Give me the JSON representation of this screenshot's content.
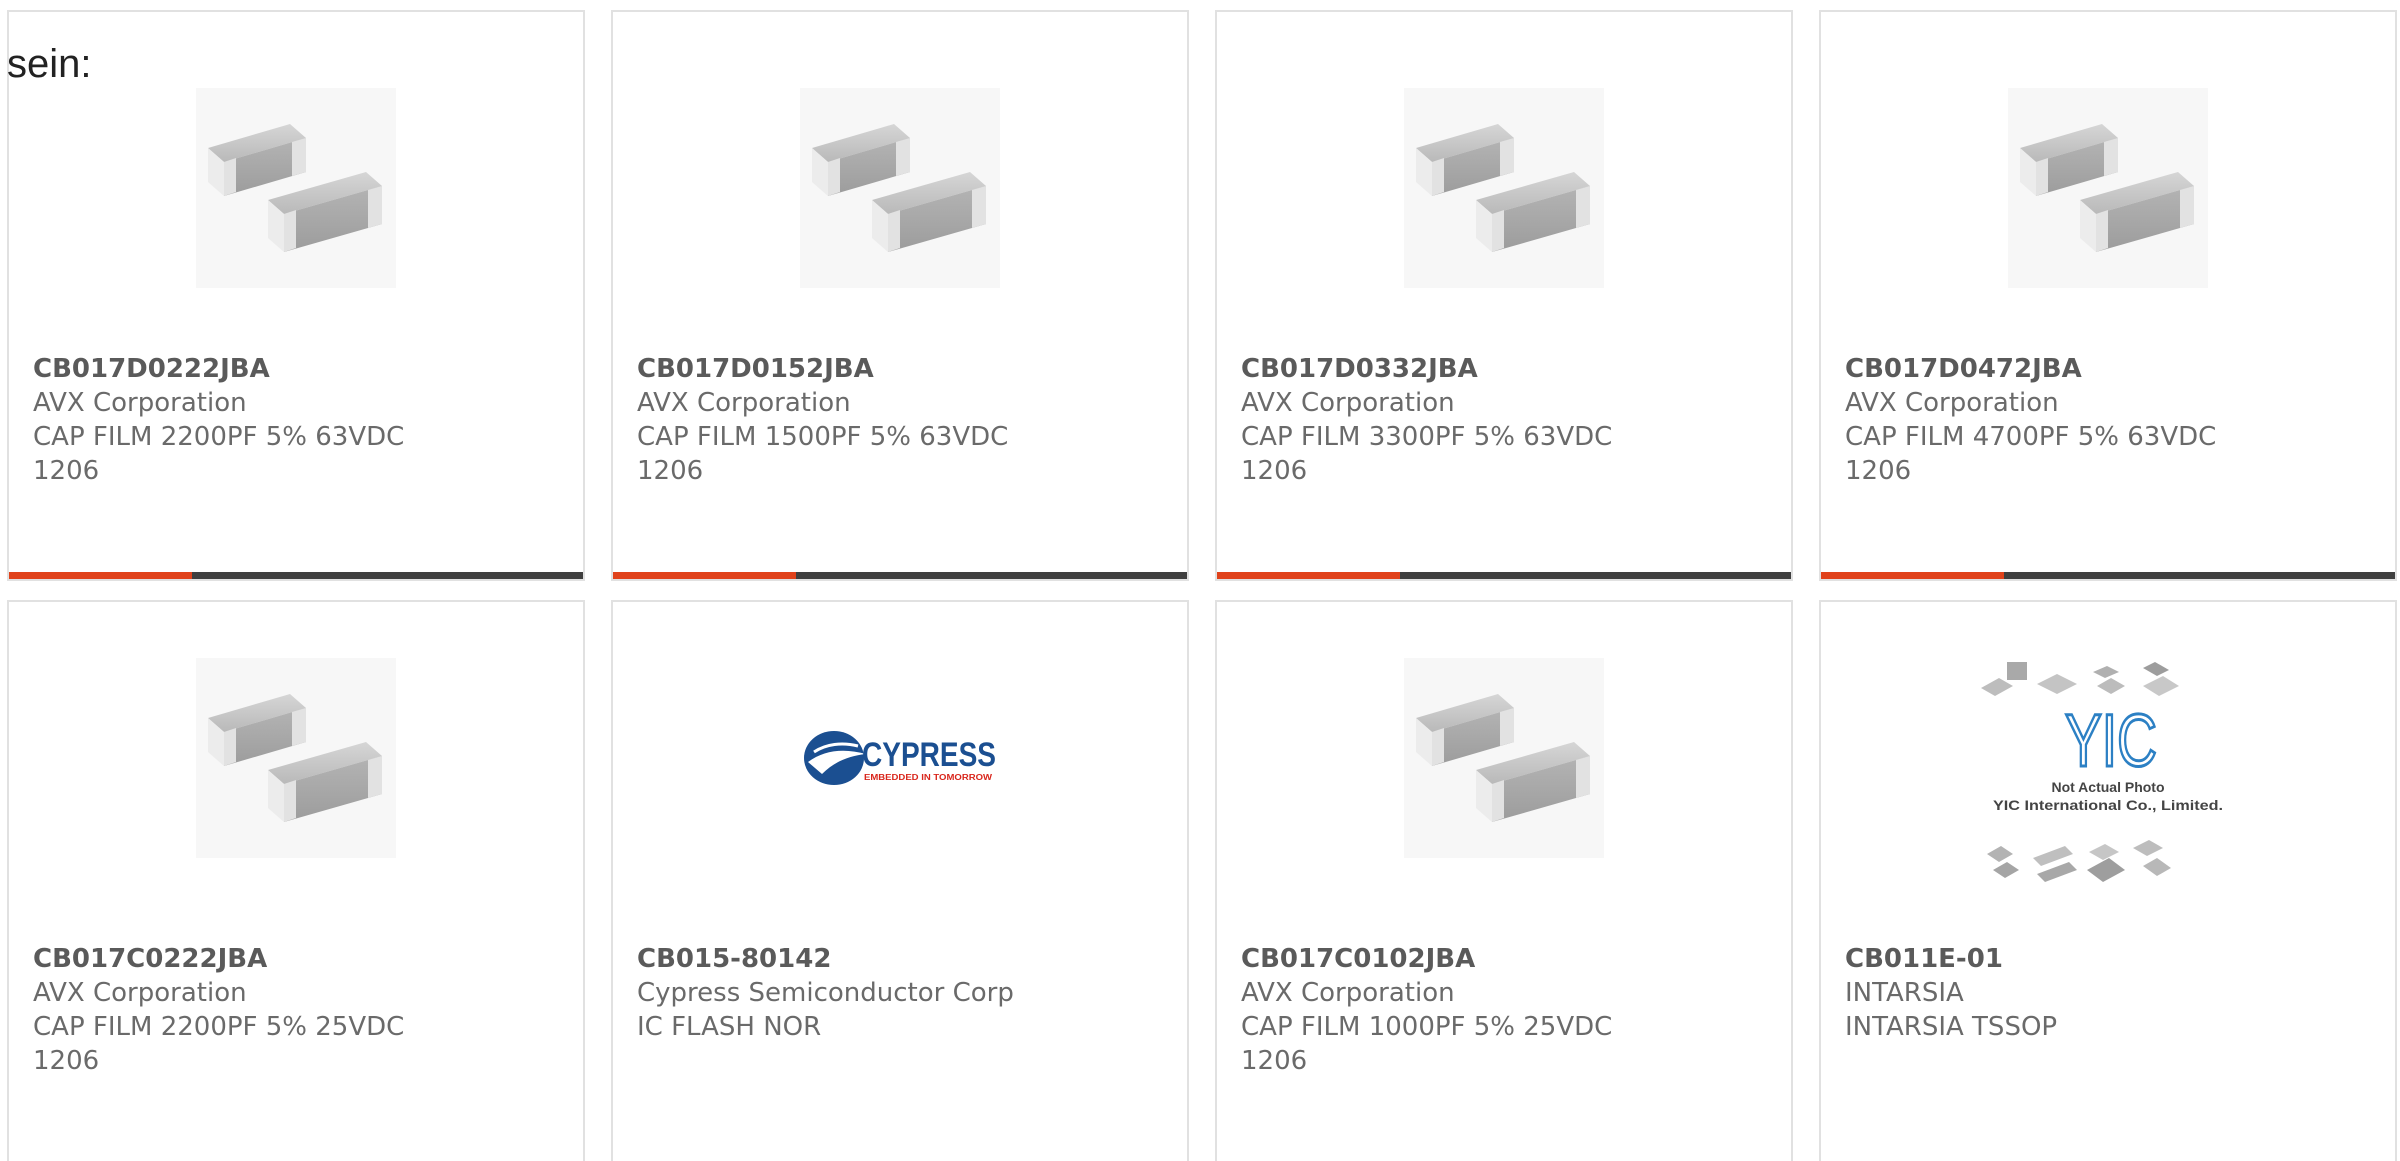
{
  "intro_text": "sein:",
  "colors": {
    "accent": "#e0421b",
    "bar": "#3f3f3f",
    "border": "#e1e1e1",
    "text": "#6a6a6a"
  },
  "products": [
    {
      "part_number": "CB017D0222JBA",
      "manufacturer": "AVX Corporation",
      "description": "CAP FILM 2200PF 5% 63VDC",
      "package": "1206",
      "image": "capacitor-chip-icon"
    },
    {
      "part_number": "CB017D0152JBA",
      "manufacturer": "AVX Corporation",
      "description": "CAP FILM 1500PF 5% 63VDC",
      "package": "1206",
      "image": "capacitor-chip-icon"
    },
    {
      "part_number": "CB017D0332JBA",
      "manufacturer": "AVX Corporation",
      "description": "CAP FILM 3300PF 5% 63VDC",
      "package": "1206",
      "image": "capacitor-chip-icon"
    },
    {
      "part_number": "CB017D0472JBA",
      "manufacturer": "AVX Corporation",
      "description": "CAP FILM 4700PF 5% 63VDC",
      "package": "1206",
      "image": "capacitor-chip-icon"
    },
    {
      "part_number": "CB017C0222JBA",
      "manufacturer": "AVX Corporation",
      "description": "CAP FILM 2200PF 5% 25VDC",
      "package": "1206",
      "image": "capacitor-chip-icon"
    },
    {
      "part_number": "CB015-80142",
      "manufacturer": "Cypress Semiconductor Corp",
      "description": "IC FLASH NOR",
      "package": "",
      "image": "cypress-logo",
      "logo_text": "CYPRESS",
      "logo_tagline": "EMBEDDED IN TOMORROW"
    },
    {
      "part_number": "CB017C0102JBA",
      "manufacturer": "AVX Corporation",
      "description": "CAP FILM 1000PF 5% 25VDC",
      "package": "1206",
      "image": "capacitor-chip-icon"
    },
    {
      "part_number": "CB011E-01",
      "manufacturer": "INTARSIA",
      "description": "INTARSIA TSSOP",
      "package": "",
      "image": "yic-placeholder",
      "logo_text": "YIC",
      "placeholder_line1": "Not Actual Photo",
      "placeholder_line2": "YIC International Co., Limited."
    }
  ]
}
